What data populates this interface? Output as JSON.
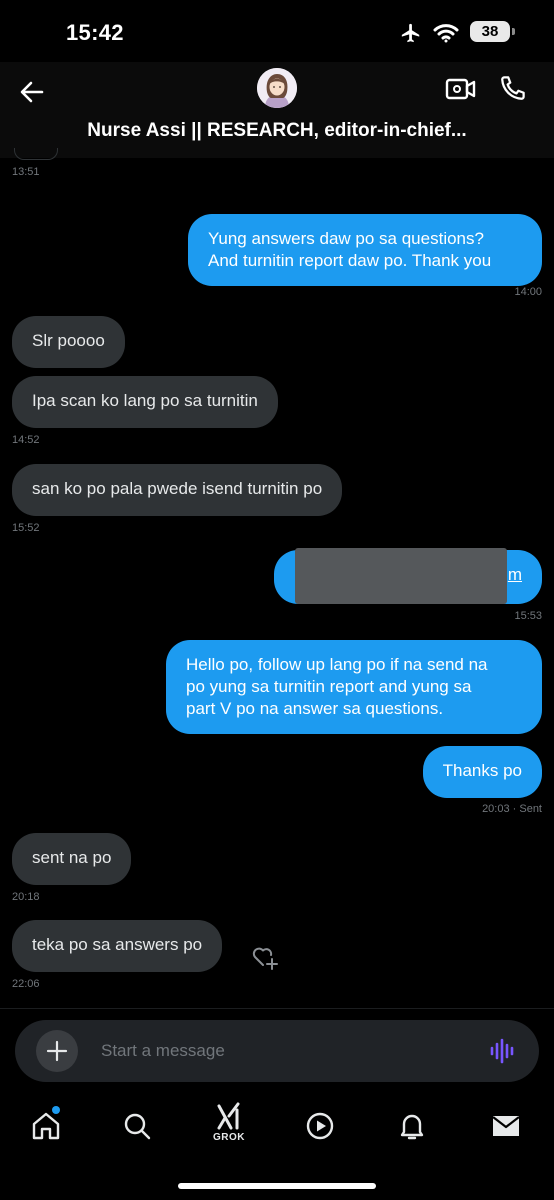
{
  "status_bar": {
    "time": "15:42",
    "battery": "38"
  },
  "header": {
    "title": "Nurse Assi || RESEARCH, editor-in-chief..."
  },
  "messages": {
    "ts_first": "13:51",
    "m1": {
      "line1": "Yung answers daw po sa questions?",
      "line2": "And turnitin report daw po. Thank you",
      "ts": "14:00"
    },
    "m2": {
      "text": "Slr poooo"
    },
    "m3": {
      "text": "Ipa scan ko lang po sa turnitin",
      "ts": "14:52"
    },
    "m4": {
      "text": "san ko po pala pwede isend turnitin po",
      "ts": "15:52"
    },
    "m5": {
      "visible_text": "m",
      "ts": "15:53"
    },
    "m6": {
      "line1": "Hello po, follow up lang po if na send na",
      "line2": "po yung sa turnitin report and yung sa",
      "line3": "part V po na answer sa questions."
    },
    "m7": {
      "text": "Thanks po",
      "ts": "20:03 · Sent"
    },
    "m8": {
      "text": "sent na po",
      "ts": "20:18"
    },
    "m9": {
      "text": "teka po sa answers po",
      "ts": "22:06"
    }
  },
  "composer": {
    "placeholder": "Start a message"
  },
  "tabbar": {
    "grok_label": "GROK"
  },
  "colors": {
    "accent": "#1d9bf0",
    "incoming_bubble": "#2f3336",
    "voice_icon": "#7856ff"
  },
  "icons": [
    "back-arrow-icon",
    "video-call-icon",
    "phone-icon",
    "plus-icon",
    "voice-wave-icon",
    "heart-plus-icon",
    "home-icon",
    "search-icon",
    "grok-icon",
    "play-icon",
    "bell-icon",
    "mail-icon"
  ]
}
